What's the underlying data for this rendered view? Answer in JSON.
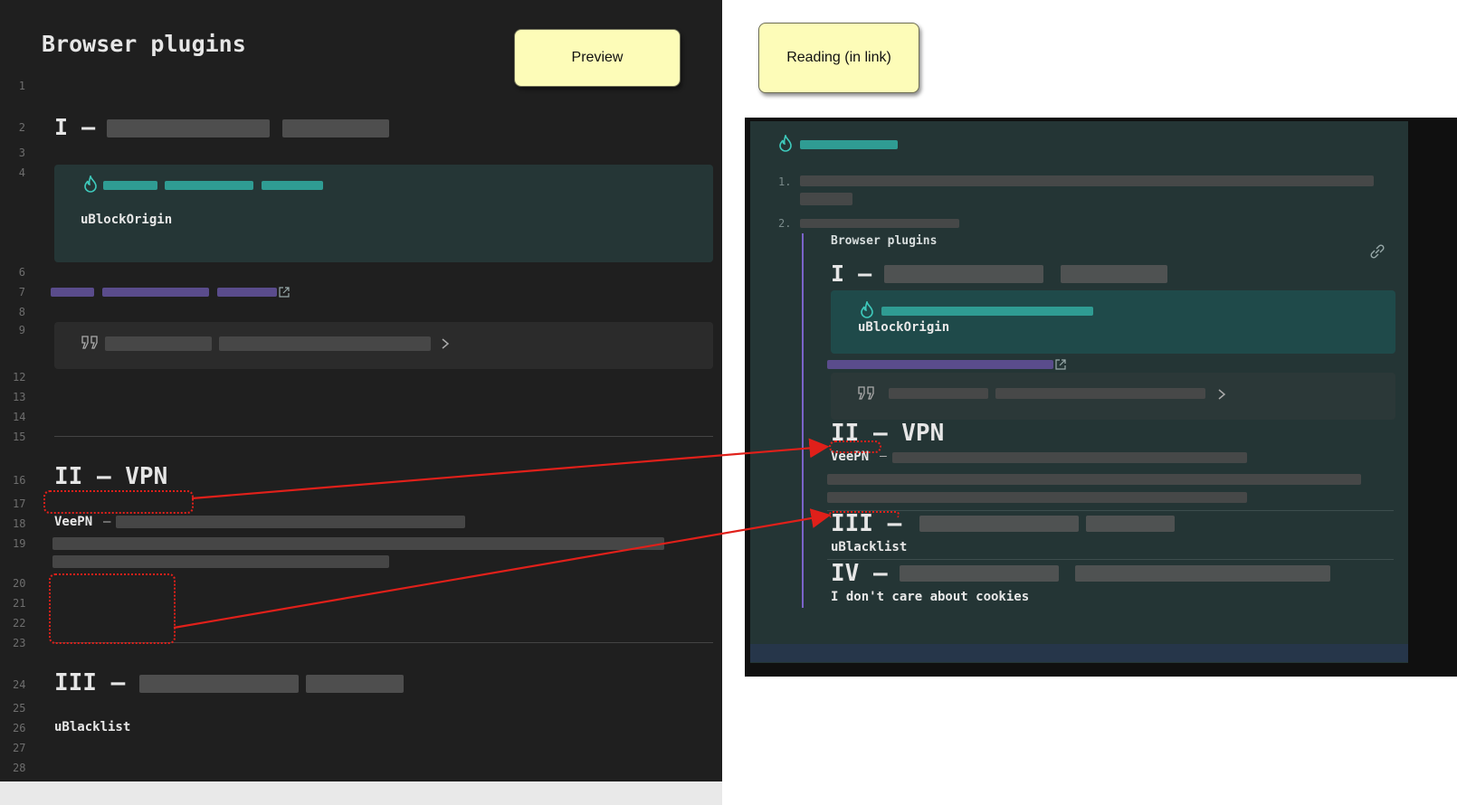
{
  "editor": {
    "title": "Browser plugins",
    "line_numbers": [
      "1",
      "2",
      "3",
      "4",
      "6",
      "7",
      "8",
      "9",
      "12",
      "13",
      "14",
      "15",
      "16",
      "17",
      "18",
      "19",
      "20",
      "21",
      "22",
      "23",
      "24",
      "25",
      "26",
      "27",
      "28"
    ],
    "headings": [
      {
        "prefix": "I —"
      },
      {
        "text": "II — VPN"
      },
      {
        "prefix": "III —"
      }
    ],
    "callout_body": "uBlockOrigin",
    "vpn_name": "VeePN",
    "vpn_separator": "–",
    "list3_item": "uBlacklist"
  },
  "buttons": {
    "preview": "Preview",
    "reading": "Reading (in link)"
  },
  "reading": {
    "list_markers": [
      "1.",
      "2."
    ],
    "embed_title": "Browser plugins",
    "headings": [
      {
        "prefix": "I —"
      },
      {
        "text": "II — VPN"
      },
      {
        "prefix": "III —"
      },
      {
        "prefix": "IV —"
      }
    ],
    "callout_body": "uBlockOrigin",
    "vpn_name": "VeePN",
    "vpn_separator": "–",
    "list3_item": "uBlacklist",
    "list4_item": "I don't care about cookies"
  },
  "colors": {
    "annotation": "#e0201a",
    "callout_bg": "#253636",
    "accent_teal": "#2f9c93",
    "link_purple": "#5a4c8c",
    "embed_border": "#7b63c9",
    "button_bg": "#fdfcb8"
  },
  "icons": [
    "flame-icon",
    "external-link-icon",
    "quote-icon",
    "chevron-right-icon",
    "link-icon"
  ]
}
